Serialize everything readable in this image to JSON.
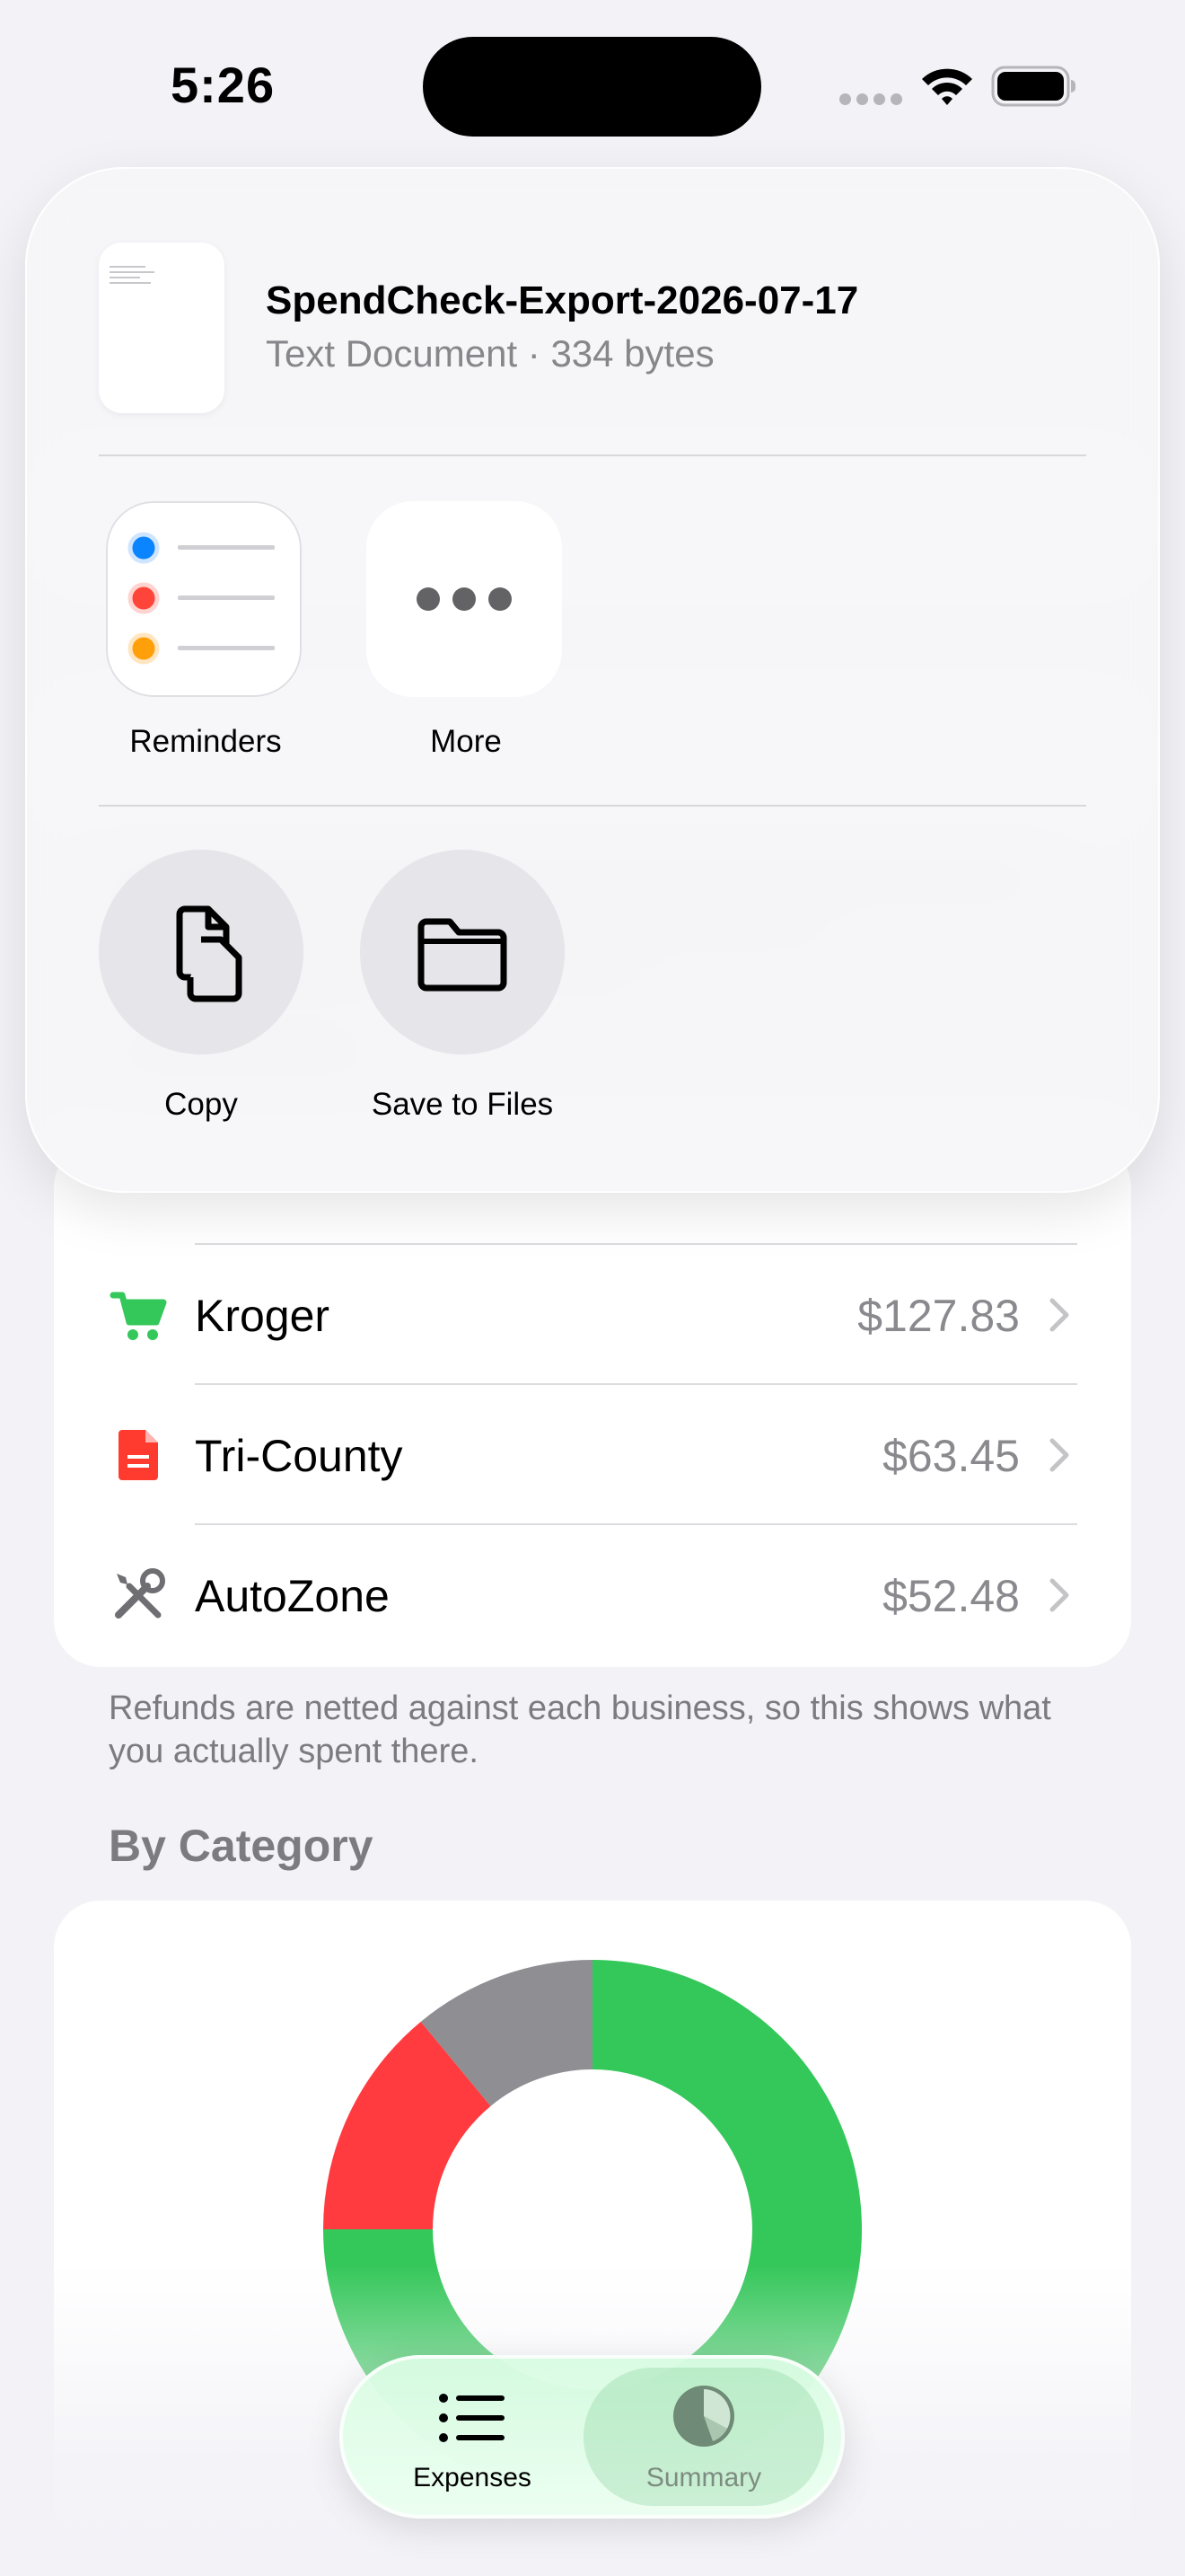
{
  "status_bar": {
    "time": "5:26"
  },
  "businesses": [
    {
      "name": "Kroger",
      "amount": "$127.83",
      "icon": "cart-icon",
      "color": "#34c759"
    },
    {
      "name": "Tri-County",
      "amount": "$63.45",
      "icon": "document-icon",
      "color": "#ff3b30"
    },
    {
      "name": "AutoZone",
      "amount": "$52.48",
      "icon": "wrench-screwdriver-icon",
      "color": "#6e6e73"
    }
  ],
  "footnote": "Refunds are netted against each business, so this shows what you actually spent there.",
  "by_category": {
    "header": "By Category",
    "slices": [
      {
        "fraction": 0.57,
        "color": "#34c759"
      },
      {
        "fraction": 0.18,
        "color": "#34c759"
      },
      {
        "fraction": 0.14,
        "color": "#ff3b3f"
      },
      {
        "fraction": 0.11,
        "color": "#8e8e93"
      }
    ]
  },
  "share_sheet": {
    "file_name": "SpendCheck-Export-2026-07-17",
    "file_info": "Text Document · 334 bytes",
    "apps": [
      {
        "label": "Reminders",
        "icon": "reminders-icon"
      },
      {
        "label": "More",
        "icon": "more-icon"
      }
    ],
    "actions": [
      {
        "label": "Copy",
        "icon": "copy-icon"
      },
      {
        "label": "Save to Files",
        "icon": "folder-icon"
      }
    ]
  },
  "tab_bar": {
    "tabs": [
      {
        "label": "Expenses",
        "icon": "list-icon",
        "selected": true
      },
      {
        "label": "Summary",
        "icon": "pie-chart-icon",
        "selected": false
      }
    ]
  },
  "colors": {
    "accent": "#34c759",
    "background": "#f2f2f7"
  }
}
